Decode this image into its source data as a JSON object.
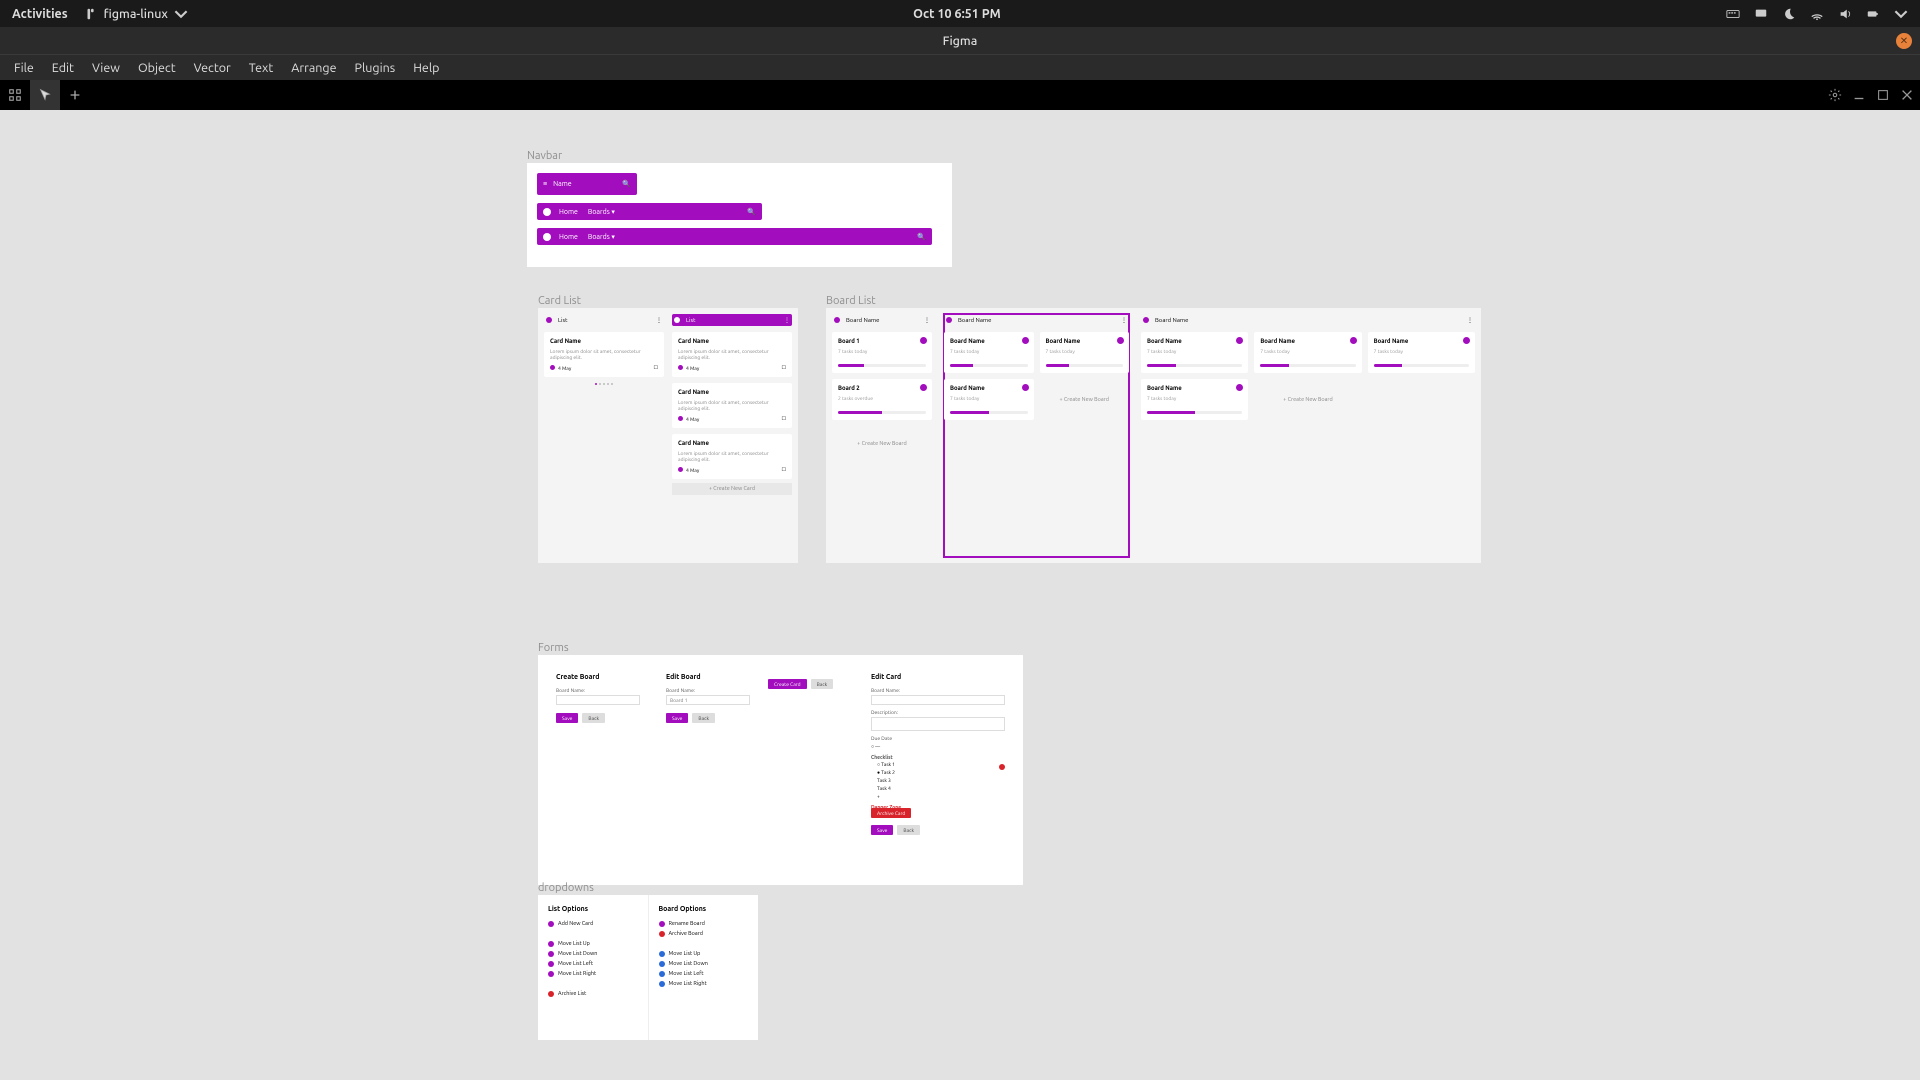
{
  "gnome": {
    "activities": "Activities",
    "app": "figma-linux",
    "clock": "Oct 10  6:51 PM"
  },
  "titlebar": {
    "title": "Figma"
  },
  "menu": [
    "File",
    "Edit",
    "View",
    "Object",
    "Vector",
    "Text",
    "Arrange",
    "Plugins",
    "Help"
  ],
  "labels": {
    "navbar": "Navbar",
    "cardlist": "Card List",
    "boardlist": "Board List",
    "forms": "Forms",
    "dropdowns": "dropdowns"
  },
  "nav": {
    "name": "Name",
    "home": "Home",
    "boards": "Boards"
  },
  "cardlist": {
    "list": "List",
    "cardname": "Card Name",
    "lorem": "Lorem ipsum dolor sit amet, consectetur adipiscing elit.",
    "date": "4 May",
    "createnew": "+   Create New Card"
  },
  "boardlist": {
    "boardname": "Board Name",
    "board1": "Board 1",
    "board2": "Board 2",
    "sub1": "7 tasks today",
    "sub2": "2 tasks overdue",
    "createnew": "+   Create New Board"
  },
  "forms": {
    "createboard": "Create Board",
    "editboard": "Edit Board",
    "editcard": "Edit Card",
    "createcard": "Create Card",
    "boardname_l": "Board Name:",
    "boardval": "Board 1",
    "description": "Description:",
    "duedate": "Due Date",
    "checklist": "Checklist",
    "task1": "Task 1",
    "task2": "Task 2",
    "task3": "Task 3",
    "task4": "Task 4",
    "danger": "Danger Zone",
    "archive": "Archive Card",
    "save": "Save",
    "back": "Back"
  },
  "dd": {
    "listopt": "List Options",
    "boardopt": "Board Options",
    "addcard": "Add New Card",
    "movelistup": "Move List Up",
    "movelistdown": "Move List Down",
    "movelistleft": "Move List Left",
    "movelistright": "Move List Right",
    "archivelist": "Archive List",
    "renameboard": "Rename Board",
    "archiveboard": "Archive Board",
    "movelu": "Move List Up",
    "moveld": "Move List Down",
    "movell": "Move List Left",
    "movelr": "Move List Right"
  }
}
